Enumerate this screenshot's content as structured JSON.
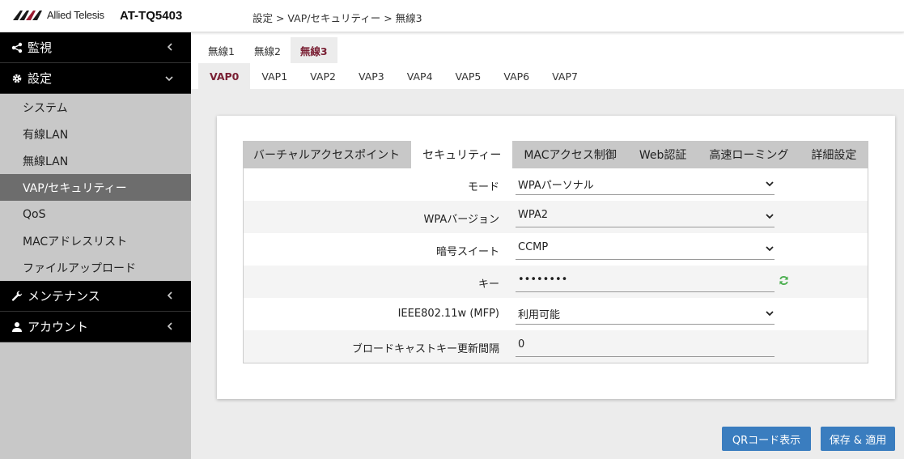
{
  "header": {
    "logo_text": "Allied Telesis",
    "model": "AT-TQ5403",
    "breadcrumb": "設定 > VAP/セキュリティー > 無線3"
  },
  "sidebar": {
    "sections": [
      {
        "label": "監視",
        "icon": "share-icon"
      },
      {
        "label": "設定",
        "icon": "gear-icon"
      }
    ],
    "settings_items": [
      {
        "label": "システム"
      },
      {
        "label": "有線LAN"
      },
      {
        "label": "無線LAN"
      },
      {
        "label": "VAP/セキュリティー",
        "active": true
      },
      {
        "label": "QoS"
      },
      {
        "label": "MACアドレスリスト"
      },
      {
        "label": "ファイルアップロード"
      }
    ],
    "bottom_sections": [
      {
        "label": "メンテナンス",
        "icon": "wrench-icon"
      },
      {
        "label": "アカウント",
        "icon": "user-icon"
      }
    ]
  },
  "radio_tabs": [
    "無線1",
    "無線2",
    "無線3"
  ],
  "vap_tabs": [
    "VAP0",
    "VAP1",
    "VAP2",
    "VAP3",
    "VAP4",
    "VAP5",
    "VAP6",
    "VAP7"
  ],
  "sub_tabs": [
    "バーチャルアクセスポイント",
    "セキュリティー",
    "MACアクセス制御",
    "Web認証",
    "高速ローミング",
    "詳細設定"
  ],
  "form": {
    "mode_label": "モード",
    "mode_value": "WPAパーソナル",
    "wpa_version_label": "WPAバージョン",
    "wpa_version_value": "WPA2",
    "cipher_label": "暗号スイート",
    "cipher_value": "CCMP",
    "key_label": "キー",
    "key_value": "••••••••",
    "mfp_label": "IEEE802.11w (MFP)",
    "mfp_value": "利用可能",
    "broadcast_label": "ブロードキャストキー更新間隔",
    "broadcast_value": "0"
  },
  "buttons": {
    "qr": "QRコード表示",
    "save": "保存 & 適用"
  },
  "colors": {
    "accent": "#7a2034",
    "button": "#3a7dbf",
    "nav_bg": "#000000",
    "sidebar_bg": "#c8c8c8"
  }
}
